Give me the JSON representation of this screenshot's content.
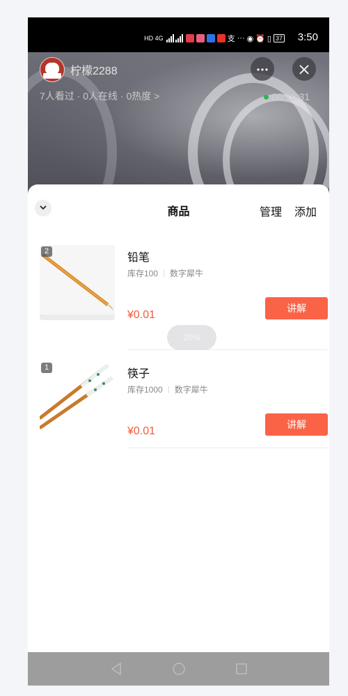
{
  "status_bar": {
    "signal_text": "HD 4G",
    "battery": "37",
    "time": "3:50"
  },
  "live": {
    "anchor_name": "柠檬2288",
    "stats": "7人看过 · 0人在线 · 0热度 >",
    "timer": "00:16:31",
    "more_icon": "more-dots-icon",
    "close_icon": "close-icon"
  },
  "sheet": {
    "title": "商品",
    "manage_label": "管理",
    "add_label": "添加",
    "collapse_icon": "chevron-down-icon"
  },
  "products": [
    {
      "badge": "2",
      "name": "铅笔",
      "stock": "库存100",
      "shop": "数字犀牛",
      "price": "¥0.01",
      "action_label": "讲解",
      "image": "pencil-image"
    },
    {
      "badge": "1",
      "name": "筷子",
      "stock": "库存1000",
      "shop": "数字犀牛",
      "price": "¥0.01",
      "action_label": "讲解",
      "image": "chopsticks-image"
    }
  ],
  "toast": {
    "text": "20%"
  },
  "nav": {
    "back_icon": "back-triangle-icon",
    "home_icon": "home-circle-icon",
    "recents_icon": "recents-square-icon"
  },
  "colors": {
    "accent": "#fb6346",
    "price": "#f05a3c",
    "live_dot": "#2fb35a"
  }
}
